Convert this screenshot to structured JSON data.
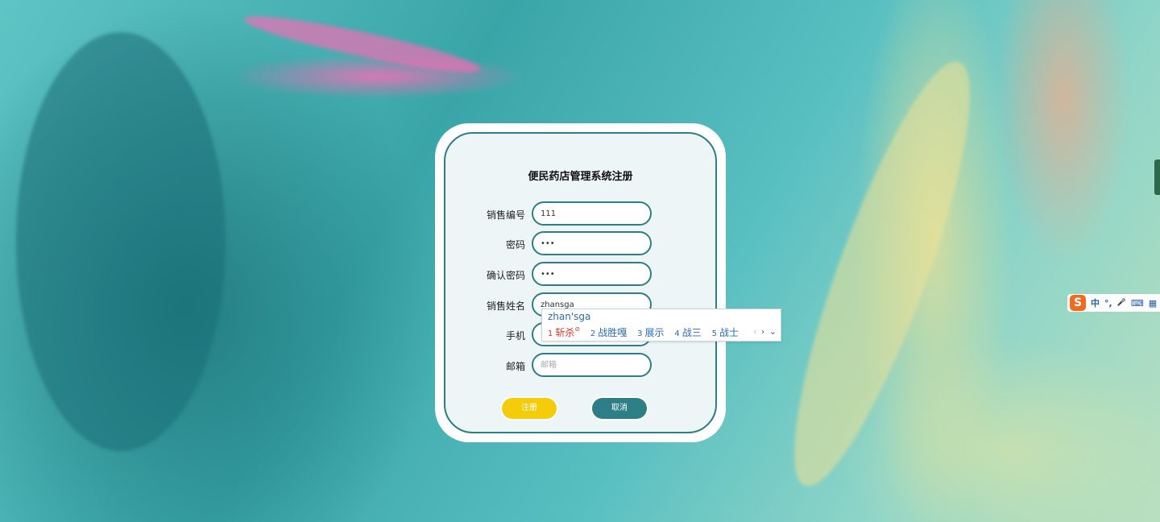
{
  "form": {
    "title": "便民药店管理系统注册",
    "fields": [
      {
        "label": "销售编号",
        "value": "111",
        "placeholder": "",
        "type": "text"
      },
      {
        "label": "密码",
        "value": "•••",
        "placeholder": "",
        "type": "text"
      },
      {
        "label": "确认密码",
        "value": "•••",
        "placeholder": "",
        "type": "text"
      },
      {
        "label": "销售姓名",
        "value": "zhansga",
        "placeholder": "",
        "type": "text"
      },
      {
        "label": "手机",
        "value": "",
        "placeholder": "",
        "type": "text"
      },
      {
        "label": "邮箱",
        "value": "",
        "placeholder": "邮箱",
        "type": "text"
      }
    ],
    "register_label": "注册",
    "cancel_label": "取消"
  },
  "ime": {
    "composition": "zhan'sga",
    "candidates": [
      {
        "num": "1",
        "text": "斩杀"
      },
      {
        "num": "2",
        "text": "战胜嘎"
      },
      {
        "num": "3",
        "text": "展示"
      },
      {
        "num": "4",
        "text": "战三"
      },
      {
        "num": "5",
        "text": "战士"
      }
    ],
    "prev": "‹",
    "next": "›",
    "expand": "⌄"
  },
  "toolbar": {
    "logo": "S",
    "lang": "中",
    "punct": "°,",
    "mic": "🎤",
    "keyboard": "⌨",
    "apps": "▦"
  },
  "colors": {
    "accent": "#2c7f87",
    "register": "#f5cc0a",
    "card_bg": "#eef5f6"
  }
}
